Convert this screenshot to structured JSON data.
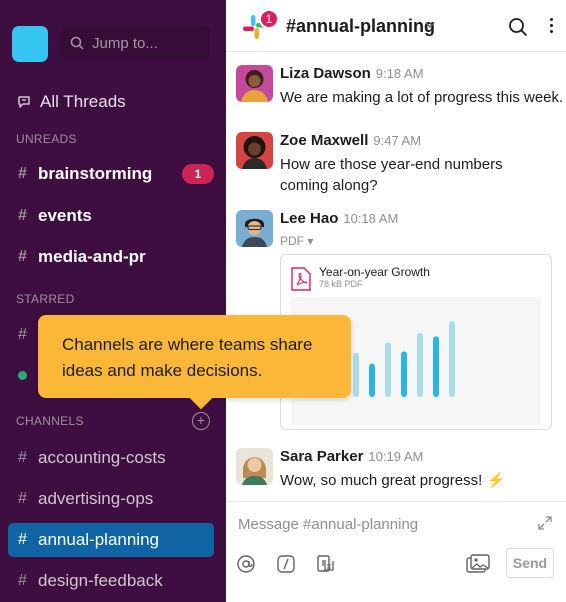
{
  "sidebar": {
    "jump_placeholder": "Jump to...",
    "all_threads_label": "All Threads",
    "unreads_header": "UNREADS",
    "starred_header": "STARRED",
    "channels_header": "CHANNELS",
    "unreads": [
      {
        "name": "brainstorming",
        "badge": "1"
      },
      {
        "name": "events"
      },
      {
        "name": "media-and-pr"
      }
    ],
    "channels": [
      {
        "name": "accounting-costs"
      },
      {
        "name": "advertising-ops"
      },
      {
        "name": "annual-planning",
        "active": true
      },
      {
        "name": "design-feedback"
      }
    ],
    "workspace_color": "#36c5f0",
    "accent": "#1164a3",
    "background": "#3f0e40"
  },
  "tooltip": {
    "text_line1": "Channels are where teams share",
    "text_line2": "ideas and make decisions."
  },
  "header": {
    "channel_title": "#annual-planning",
    "notification_count": "1"
  },
  "messages": [
    {
      "author": "Liza Dawson",
      "time": "9:18 AM",
      "text": "We are making a lot of progress this week."
    },
    {
      "author": "Zoe Maxwell",
      "time": "9:47 AM",
      "text_line1": "How are those year-end numbers",
      "text_line2": "coming along?"
    },
    {
      "author": "Lee Hao",
      "time": "10:18 AM",
      "attachment_type": "PDF",
      "file": {
        "name": "Year-on-year Growth",
        "meta": "78 kB PDF"
      }
    },
    {
      "author": "Sara Parker",
      "time": "10:19 AM",
      "text": "Wow, so much great progress!"
    }
  ],
  "composer": {
    "placeholder": "Message #annual-planning",
    "send_label": "Send"
  },
  "chart_data": {
    "type": "bar",
    "series": [
      {
        "values": [
          0.42,
          0.5,
          0.58,
          0.66,
          0.72,
          0.78,
          0.84,
          0.9,
          1.0
        ]
      },
      {
        "values": [
          0.22,
          0.28,
          0.36,
          0.44,
          0.52,
          0.6,
          0.7,
          0.8,
          0.9
        ]
      }
    ]
  }
}
